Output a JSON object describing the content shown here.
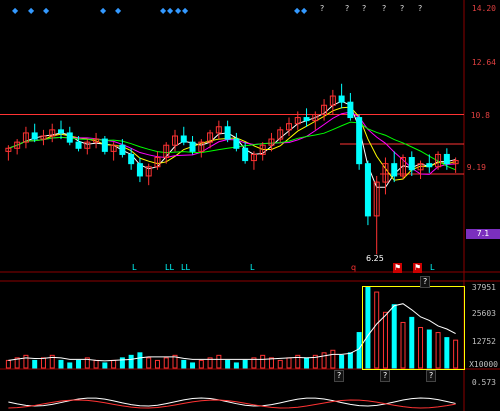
{
  "header": {
    "price_top": "14.20",
    "toolbar_icons": [
      "diamond",
      "diamond",
      "diamond",
      "diamond",
      "diamond",
      "diamond",
      "diamond",
      "diamond",
      "diamond",
      "diamond"
    ],
    "menu_labels": [
      "?",
      "?",
      "?",
      "?",
      "?",
      "?"
    ]
  },
  "price_axis": [
    "14.20",
    "12.64",
    "10.8",
    "9.19",
    "7.1"
  ],
  "price_tag": "7.1",
  "low_label": "6.25",
  "markers": [
    "L",
    "LL",
    "LL",
    "L",
    "q",
    "L"
  ],
  "volume_axis": [
    "37951",
    "25603",
    "12752",
    "X10000"
  ],
  "volume_tabs": [
    "?",
    "?",
    "?"
  ],
  "volume_popup_label": "?",
  "bottom_axis": "0.573",
  "colors": {
    "background": "#000000",
    "up": "#ff3333",
    "down": "#00ffff",
    "ma1": "#ffffff",
    "ma2": "#ffff00",
    "ma3": "#ff00ff",
    "ma4": "#00ff00",
    "grid": "#8b0000",
    "price_tag_bg": "#7b2fbe"
  },
  "chart_data": {
    "type": "candlestick",
    "ylim": [
      6.0,
      14.2
    ],
    "candles": [
      {
        "o": 9.6,
        "h": 9.8,
        "l": 9.3,
        "c": 9.7
      },
      {
        "o": 9.7,
        "h": 10.0,
        "l": 9.5,
        "c": 9.9
      },
      {
        "o": 9.9,
        "h": 10.4,
        "l": 9.7,
        "c": 10.2
      },
      {
        "o": 10.2,
        "h": 10.5,
        "l": 9.9,
        "c": 10.0
      },
      {
        "o": 10.0,
        "h": 10.3,
        "l": 9.8,
        "c": 10.1
      },
      {
        "o": 10.1,
        "h": 10.5,
        "l": 9.9,
        "c": 10.3
      },
      {
        "o": 10.3,
        "h": 10.6,
        "l": 10.0,
        "c": 10.2
      },
      {
        "o": 10.2,
        "h": 10.4,
        "l": 9.8,
        "c": 9.9
      },
      {
        "o": 9.9,
        "h": 10.1,
        "l": 9.6,
        "c": 9.7
      },
      {
        "o": 9.7,
        "h": 10.0,
        "l": 9.5,
        "c": 9.9
      },
      {
        "o": 9.9,
        "h": 10.2,
        "l": 9.7,
        "c": 10.0
      },
      {
        "o": 10.0,
        "h": 10.1,
        "l": 9.5,
        "c": 9.6
      },
      {
        "o": 9.6,
        "h": 9.9,
        "l": 9.3,
        "c": 9.8
      },
      {
        "o": 9.8,
        "h": 10.0,
        "l": 9.4,
        "c": 9.5
      },
      {
        "o": 9.5,
        "h": 9.7,
        "l": 9.0,
        "c": 9.2
      },
      {
        "o": 9.2,
        "h": 9.4,
        "l": 8.6,
        "c": 8.8
      },
      {
        "o": 8.8,
        "h": 9.2,
        "l": 8.5,
        "c": 9.1
      },
      {
        "o": 9.1,
        "h": 9.6,
        "l": 9.0,
        "c": 9.4
      },
      {
        "o": 9.4,
        "h": 9.9,
        "l": 9.2,
        "c": 9.8
      },
      {
        "o": 9.8,
        "h": 10.3,
        "l": 9.6,
        "c": 10.1
      },
      {
        "o": 10.1,
        "h": 10.4,
        "l": 9.8,
        "c": 9.9
      },
      {
        "o": 9.9,
        "h": 10.1,
        "l": 9.5,
        "c": 9.6
      },
      {
        "o": 9.6,
        "h": 10.0,
        "l": 9.4,
        "c": 9.9
      },
      {
        "o": 9.9,
        "h": 10.3,
        "l": 9.7,
        "c": 10.2
      },
      {
        "o": 10.2,
        "h": 10.6,
        "l": 10.0,
        "c": 10.4
      },
      {
        "o": 10.4,
        "h": 10.6,
        "l": 9.9,
        "c": 10.0
      },
      {
        "o": 10.0,
        "h": 10.2,
        "l": 9.6,
        "c": 9.7
      },
      {
        "o": 9.7,
        "h": 9.9,
        "l": 9.2,
        "c": 9.3
      },
      {
        "o": 9.3,
        "h": 9.6,
        "l": 9.0,
        "c": 9.5
      },
      {
        "o": 9.5,
        "h": 9.9,
        "l": 9.3,
        "c": 9.8
      },
      {
        "o": 9.8,
        "h": 10.2,
        "l": 9.6,
        "c": 10.0
      },
      {
        "o": 10.0,
        "h": 10.4,
        "l": 9.9,
        "c": 10.3
      },
      {
        "o": 10.3,
        "h": 10.7,
        "l": 10.1,
        "c": 10.5
      },
      {
        "o": 10.5,
        "h": 10.9,
        "l": 10.3,
        "c": 10.7
      },
      {
        "o": 10.7,
        "h": 11.0,
        "l": 10.4,
        "c": 10.6
      },
      {
        "o": 10.6,
        "h": 10.9,
        "l": 10.3,
        "c": 10.8
      },
      {
        "o": 10.8,
        "h": 11.3,
        "l": 10.6,
        "c": 11.1
      },
      {
        "o": 11.1,
        "h": 11.6,
        "l": 10.8,
        "c": 11.4
      },
      {
        "o": 11.4,
        "h": 11.8,
        "l": 11.0,
        "c": 11.2
      },
      {
        "o": 11.2,
        "h": 11.5,
        "l": 10.6,
        "c": 10.7
      },
      {
        "o": 10.7,
        "h": 10.8,
        "l": 9.0,
        "c": 9.2
      },
      {
        "o": 9.2,
        "h": 9.3,
        "l": 7.2,
        "c": 7.5
      },
      {
        "o": 7.5,
        "h": 8.8,
        "l": 6.25,
        "c": 8.6
      },
      {
        "o": 8.6,
        "h": 9.4,
        "l": 8.2,
        "c": 9.2
      },
      {
        "o": 9.2,
        "h": 9.6,
        "l": 8.6,
        "c": 8.8
      },
      {
        "o": 8.8,
        "h": 9.5,
        "l": 8.7,
        "c": 9.4
      },
      {
        "o": 9.4,
        "h": 9.6,
        "l": 8.8,
        "c": 9.0
      },
      {
        "o": 9.0,
        "h": 9.3,
        "l": 8.7,
        "c": 9.2
      },
      {
        "o": 9.2,
        "h": 9.5,
        "l": 8.9,
        "c": 9.1
      },
      {
        "o": 9.1,
        "h": 9.6,
        "l": 9.0,
        "c": 9.5
      },
      {
        "o": 9.5,
        "h": 9.7,
        "l": 9.0,
        "c": 9.2
      },
      {
        "o": 9.2,
        "h": 9.4,
        "l": 8.9,
        "c": 9.3
      }
    ],
    "volume": [
      3,
      4,
      5,
      3,
      4,
      5,
      3,
      2,
      3,
      4,
      3,
      2,
      3,
      4,
      5,
      6,
      4,
      3,
      4,
      5,
      3,
      2,
      3,
      4,
      5,
      3,
      2,
      3,
      4,
      5,
      4,
      3,
      4,
      5,
      4,
      5,
      6,
      7,
      5,
      6,
      14,
      32,
      30,
      22,
      25,
      18,
      20,
      16,
      15,
      14,
      12,
      11
    ],
    "hline_levels": [
      10.8,
      9.19
    ]
  }
}
